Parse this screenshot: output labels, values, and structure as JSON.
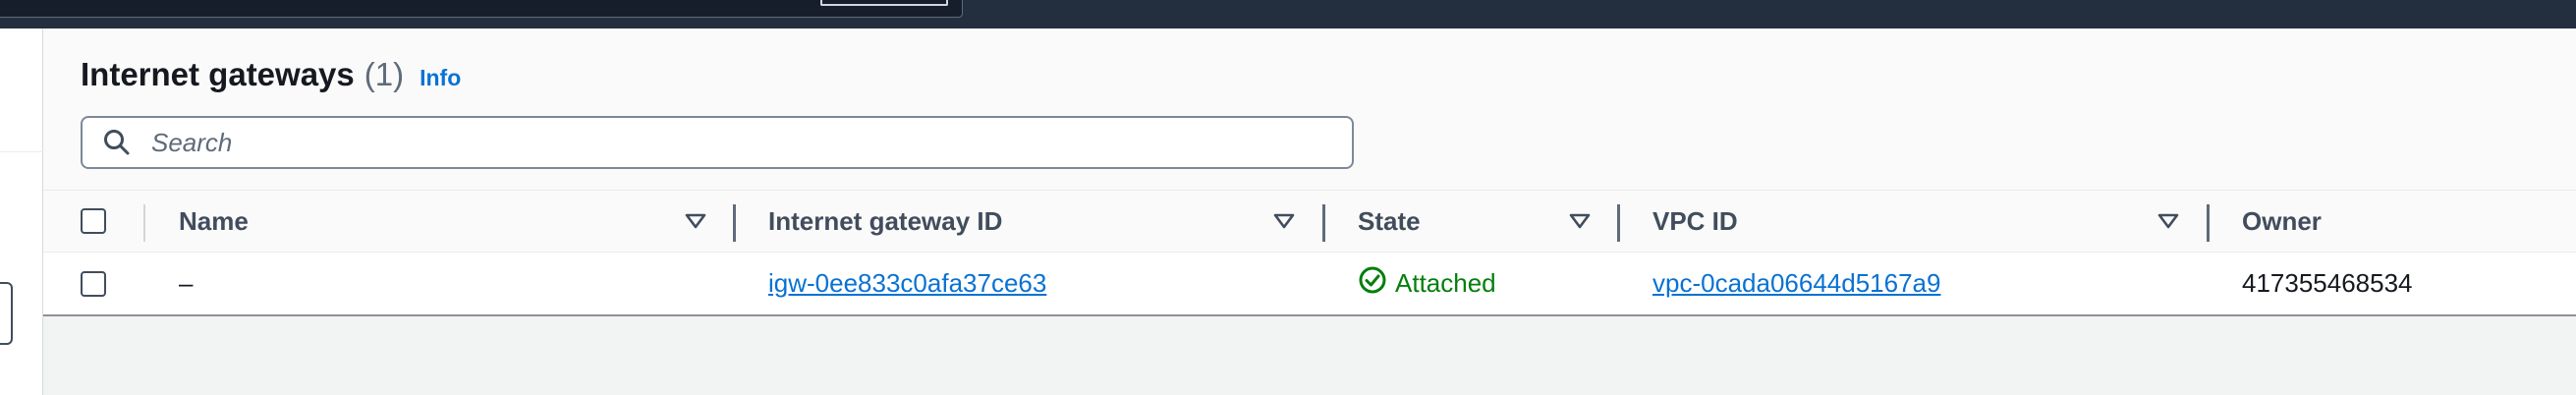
{
  "header": {
    "title": "Internet gateways",
    "count": "(1)",
    "info_link": "Info"
  },
  "search": {
    "placeholder": "Search",
    "value": ""
  },
  "table": {
    "columns": [
      {
        "label": "Name",
        "sortable": true
      },
      {
        "label": "Internet gateway ID",
        "sortable": true
      },
      {
        "label": "State",
        "sortable": true
      },
      {
        "label": "VPC ID",
        "sortable": true
      },
      {
        "label": "Owner",
        "sortable": false
      }
    ],
    "rows": [
      {
        "name": "–",
        "gateway_id": "igw-0ee833c0afa37ce63",
        "state": "Attached",
        "vpc_id": "vpc-0cada06644d5167a9",
        "owner": "417355468534"
      }
    ]
  },
  "colors": {
    "topbar": "#232f3e",
    "link": "#0972d3",
    "success": "#037f0c",
    "text": "#16191f"
  },
  "icons": [
    "search-icon",
    "sort-caret-icon",
    "status-success-icon"
  ]
}
